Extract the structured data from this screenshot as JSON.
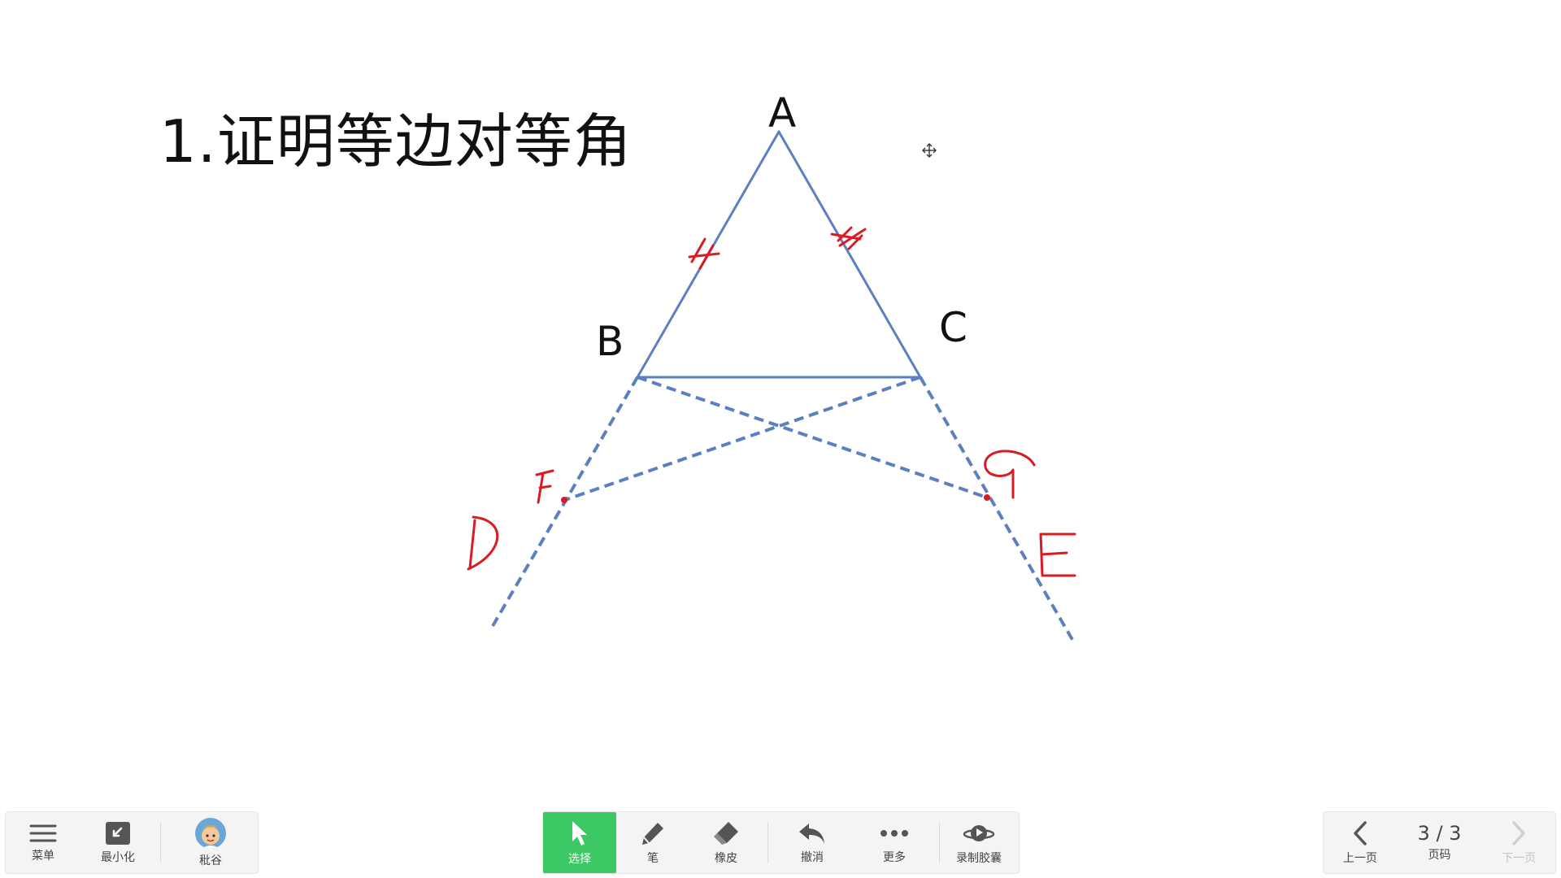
{
  "slide": {
    "title": "1.证明等边对等角",
    "vertices": {
      "a": "A",
      "b": "B",
      "c": "C"
    }
  },
  "colors": {
    "geometry_line": "#5b7fbf",
    "annotation_ink": "#d71c24",
    "active_tool": "#3cc864",
    "toolbar_bg": "#f4f4f4"
  },
  "toolbar_left": {
    "menu": {
      "label": "菜单",
      "icon": "hamburger-icon"
    },
    "minimize": {
      "label": "最小化",
      "icon": "minimize-icon"
    },
    "user": {
      "label": "秕谷",
      "icon": "avatar"
    }
  },
  "toolbar_center": {
    "select": {
      "label": "选择",
      "icon": "cursor-arrow-icon",
      "active": true
    },
    "pen": {
      "label": "笔",
      "icon": "pen-icon"
    },
    "eraser": {
      "label": "橡皮",
      "icon": "eraser-icon"
    },
    "undo": {
      "label": "撤消",
      "icon": "undo-icon"
    },
    "more": {
      "label": "更多",
      "icon": "more-dots-icon"
    },
    "record": {
      "label": "录制胶囊",
      "icon": "record-capsule-icon"
    }
  },
  "toolbar_right": {
    "prev": {
      "label": "上一页",
      "icon": "chevron-left-icon"
    },
    "page": {
      "value": "3 / 3",
      "label": "页码"
    },
    "next": {
      "label": "下一页",
      "icon": "chevron-right-icon",
      "disabled": true
    }
  }
}
